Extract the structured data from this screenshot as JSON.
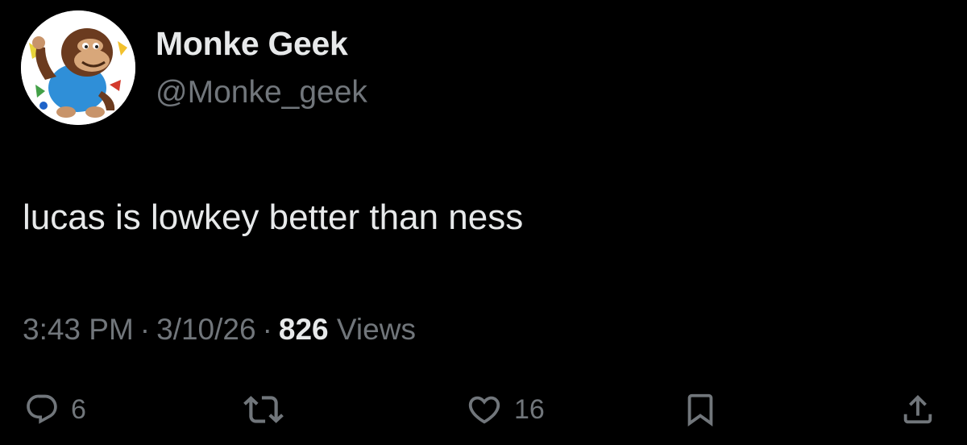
{
  "author": {
    "display_name": "Monke Geek",
    "handle": "@Monke_geek",
    "avatar_icon": "monkey-avatar"
  },
  "tweet": {
    "text": "lucas is lowkey better than ness"
  },
  "meta": {
    "time": "3:43 PM",
    "separator": "·",
    "date": "3/10/26",
    "views_count": "826",
    "views_label": "Views"
  },
  "actions": {
    "reply_count": "6",
    "like_count": "16"
  },
  "colors": {
    "background": "#000000",
    "primary_text": "#e7e9ea",
    "secondary_text": "#71767b"
  }
}
